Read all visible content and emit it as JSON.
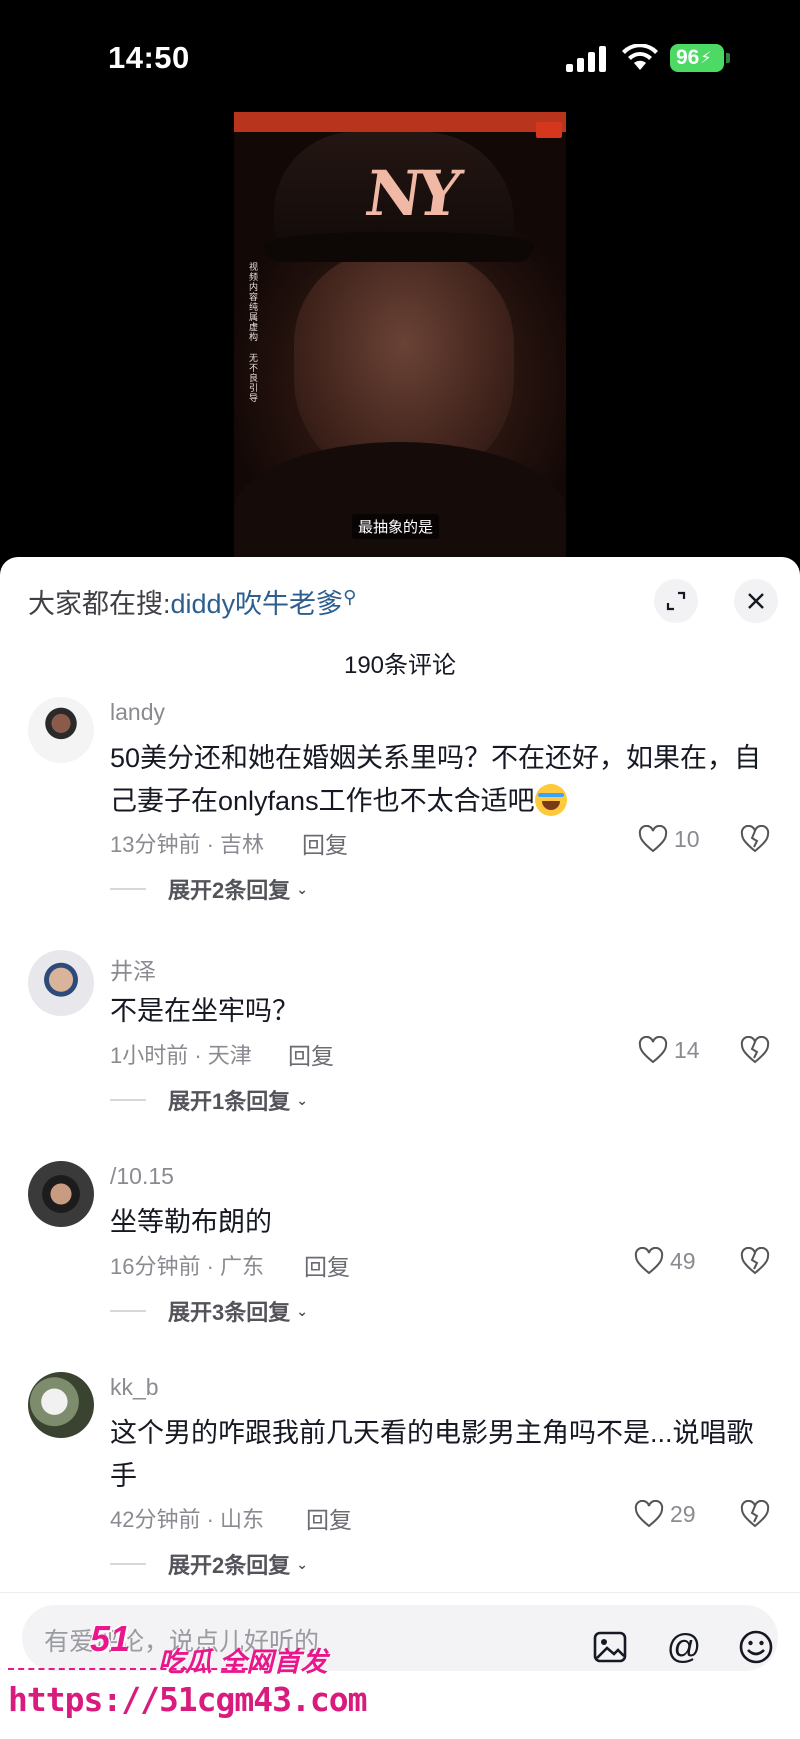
{
  "status_bar": {
    "time": "14:50",
    "battery": "96"
  },
  "video": {
    "side_text": "视频内容纯属虚构 无不良引导",
    "subtitle": "最抽象的是"
  },
  "sheet": {
    "search_prefix": "大家都在搜:",
    "search_keyword": "diddy吹牛老爹",
    "comment_count": "190条评论"
  },
  "comments": [
    {
      "username": "landy",
      "text": "50美分还和她在婚姻关系里吗？不在还好，如果在，自己妻子在onlyfans工作也不太合适吧",
      "meta": "13分钟前 · 吉林",
      "reply": "回复",
      "likes": "10",
      "expand": "展开2条回复"
    },
    {
      "username": "井泽",
      "text": "不是在坐牢吗？",
      "meta": "1小时前 · 天津",
      "reply": "回复",
      "likes": "14",
      "expand": "展开1条回复"
    },
    {
      "username": "/10.15",
      "text": "坐等勒布朗的",
      "meta": "16分钟前 · 广东",
      "reply": "回复",
      "likes": "49",
      "expand": "展开3条回复"
    },
    {
      "username": "kk_b",
      "text": "这个男的咋跟我前几天看的电影男主角吗不是...说唱歌手",
      "meta": "42分钟前 · 山东",
      "reply": "回复",
      "likes": "29",
      "expand": "展开2条回复"
    }
  ],
  "input": {
    "placeholder": "有爱评论，说点儿好听的"
  },
  "watermark": {
    "logo": "51",
    "slogan": "吃瓜 全网首发",
    "url": "https://51cgm43.com"
  },
  "colors": {
    "accent_keyword": "#2c5f8f",
    "battery": "#4cd964",
    "watermark": "#e9168c"
  }
}
